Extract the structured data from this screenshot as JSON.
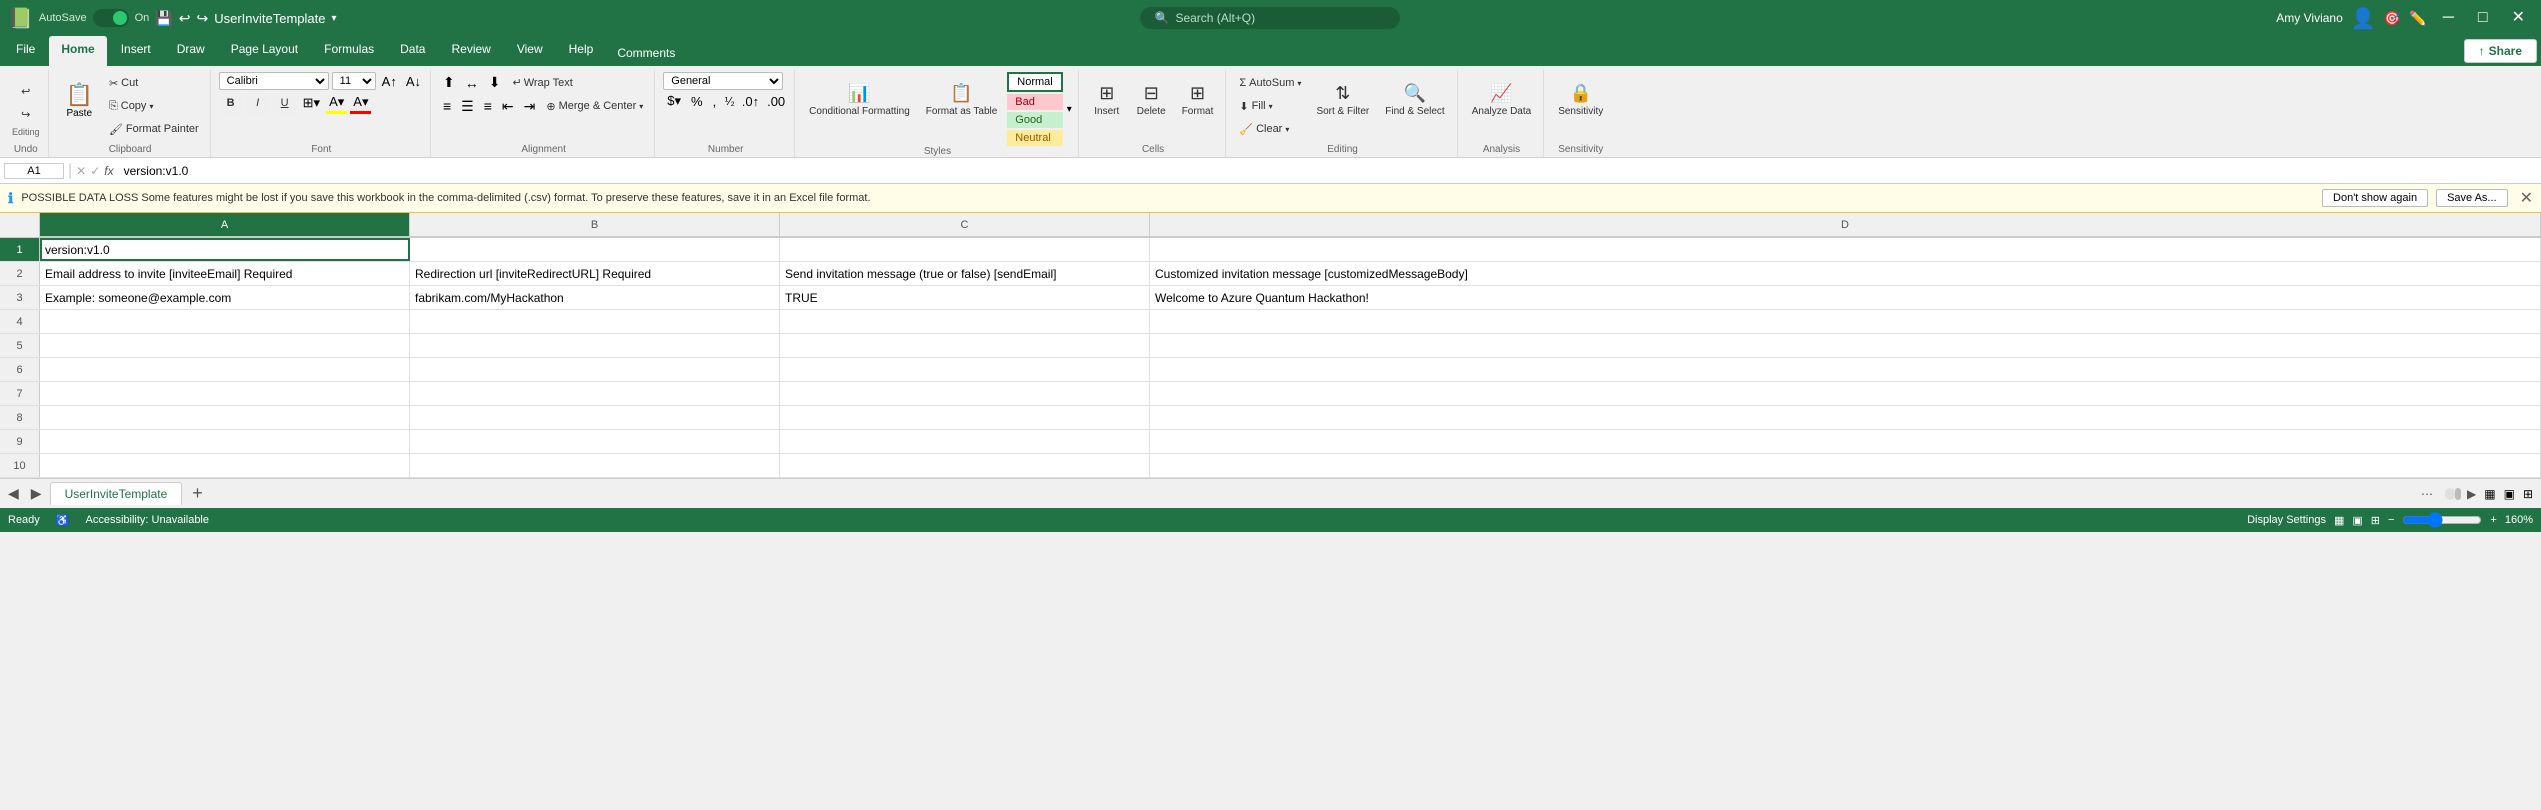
{
  "titleBar": {
    "autosave": "AutoSave",
    "autosaveState": "On",
    "filename": "UserInviteTemplate",
    "searchPlaceholder": "Search (Alt+Q)",
    "userName": "Amy Viviano",
    "minimize": "─",
    "restore": "□",
    "close": "✕"
  },
  "ribbonTabs": {
    "tabs": [
      "File",
      "Home",
      "Insert",
      "Draw",
      "Page Layout",
      "Formulas",
      "Data",
      "Review",
      "View",
      "Help"
    ],
    "active": "Home",
    "comments": "Comments",
    "share": "Share"
  },
  "ribbon": {
    "clipboard": {
      "paste": "Paste",
      "cut": "Cut",
      "copy": "Copy",
      "formatPainter": "Format Painter",
      "label": "Clipboard"
    },
    "font": {
      "fontName": "Calibri",
      "fontSize": "11",
      "bold": "B",
      "italic": "I",
      "underline": "U",
      "label": "Font"
    },
    "alignment": {
      "wrapText": "Wrap Text",
      "mergeCenter": "Merge & Center",
      "label": "Alignment"
    },
    "number": {
      "format": "General",
      "label": "Number"
    },
    "styles": {
      "conditionalFormatting": "Conditional Formatting",
      "formatAsTable": "Format as Table",
      "normal": "Normal",
      "bad": "Bad",
      "good": "Good",
      "neutral": "Neutral",
      "label": "Styles"
    },
    "cells": {
      "insert": "Insert",
      "delete": "Delete",
      "format": "Format",
      "label": "Cells"
    },
    "editing": {
      "autoSum": "AutoSum",
      "fill": "Fill",
      "clear": "Clear",
      "sortFilter": "Sort & Filter",
      "findSelect": "Find & Select",
      "label": "Editing"
    },
    "analysis": {
      "analyzeData": "Analyze Data",
      "label": "Analysis"
    },
    "sensitivity": {
      "label": "Sensitivity"
    }
  },
  "formulaBar": {
    "cellRef": "A1",
    "formula": "version:v1.0"
  },
  "warningBar": {
    "text": "POSSIBLE DATA LOSS  Some features might be lost if you save this workbook in the comma-delimited (.csv) format. To preserve these features, save it in an Excel file format.",
    "dontShow": "Don't show again",
    "saveAs": "Save As..."
  },
  "columns": {
    "headers": [
      "A",
      "B",
      "C",
      "D"
    ]
  },
  "rows": [
    {
      "num": "1",
      "a": "version:v1.0",
      "b": "",
      "c": "",
      "d": ""
    },
    {
      "num": "2",
      "a": "Email address to invite [inviteeEmail] Required",
      "b": "Redirection url [inviteRedirectURL] Required",
      "c": "Send invitation message (true or false) [sendEmail]",
      "d": "Customized invitation message [customizedMessageBody]"
    },
    {
      "num": "3",
      "a": "Example:    someone@example.com",
      "b": "fabrikam.com/MyHackathon",
      "c": "TRUE",
      "d": "Welcome to Azure Quantum Hackathon!"
    },
    {
      "num": "4",
      "a": "",
      "b": "",
      "c": "",
      "d": ""
    },
    {
      "num": "5",
      "a": "",
      "b": "",
      "c": "",
      "d": ""
    },
    {
      "num": "6",
      "a": "",
      "b": "",
      "c": "",
      "d": ""
    },
    {
      "num": "7",
      "a": "",
      "b": "",
      "c": "",
      "d": ""
    },
    {
      "num": "8",
      "a": "",
      "b": "",
      "c": "",
      "d": ""
    },
    {
      "num": "9",
      "a": "",
      "b": "",
      "c": "",
      "d": ""
    },
    {
      "num": "10",
      "a": "",
      "b": "",
      "c": "",
      "d": ""
    }
  ],
  "sheetTabs": {
    "tabs": [
      "UserInviteTemplate"
    ],
    "active": "UserInviteTemplate"
  },
  "statusBar": {
    "ready": "Ready",
    "accessibility": "Accessibility: Unavailable",
    "displaySettings": "Display Settings",
    "zoom": "160%"
  }
}
